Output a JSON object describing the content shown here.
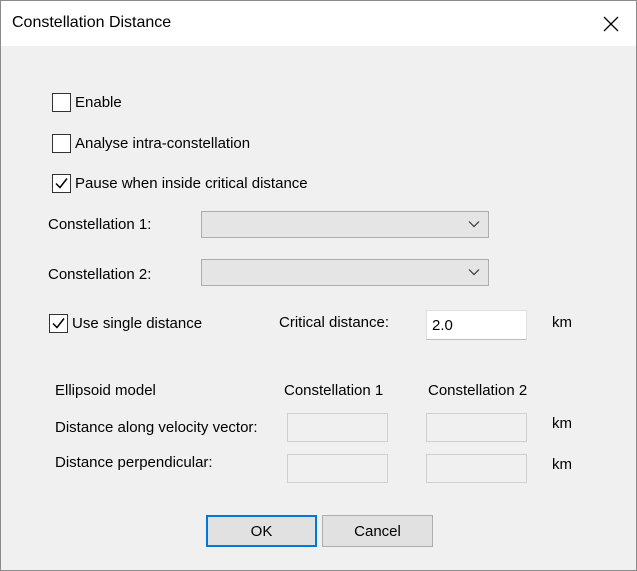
{
  "window": {
    "title": "Constellation Distance"
  },
  "options": {
    "enable": {
      "label": "Enable",
      "checked": false
    },
    "intra": {
      "label": "Analyse intra-constellation",
      "checked": false
    },
    "pause": {
      "label": "Pause when inside critical distance",
      "checked": true
    }
  },
  "constellation1": {
    "label": "Constellation 1:",
    "value": ""
  },
  "constellation2": {
    "label": "Constellation 2:",
    "value": ""
  },
  "single_distance": {
    "label": "Use single distance",
    "checked": true
  },
  "critical": {
    "label": "Critical distance:",
    "value": "2.0",
    "unit": "km"
  },
  "ellipsoid": {
    "header": "Ellipsoid model",
    "col1": "Constellation 1",
    "col2": "Constellation 2",
    "along_label": "Distance along velocity vector:",
    "along_unit": "km",
    "perp_label": "Distance perpendicular:",
    "perp_unit": "km",
    "along_c1": "",
    "along_c2": "",
    "perp_c1": "",
    "perp_c2": ""
  },
  "buttons": {
    "ok": "OK",
    "cancel": "Cancel"
  },
  "colors": {
    "accent": "#0078d7"
  }
}
